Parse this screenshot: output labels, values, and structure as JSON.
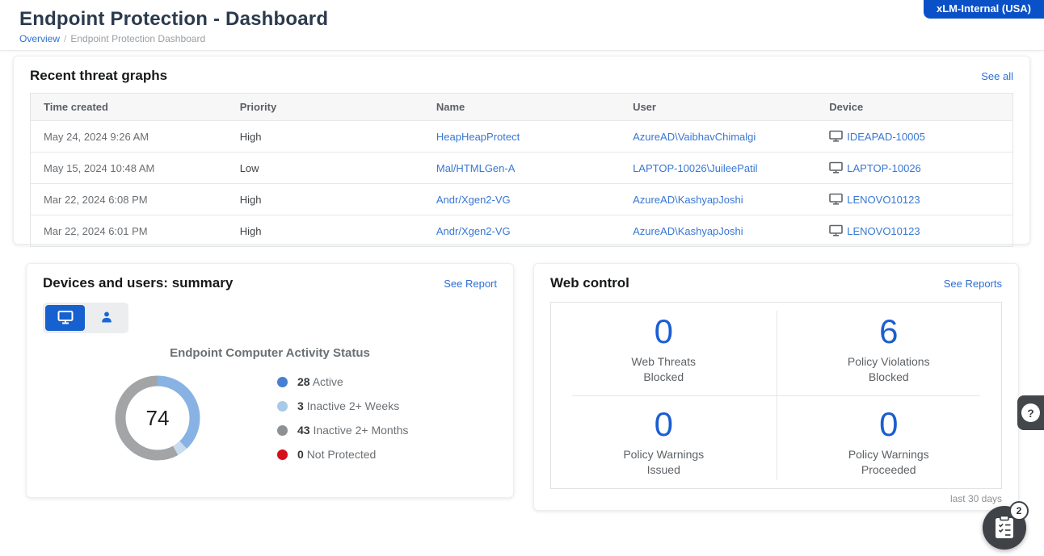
{
  "page": {
    "title": "Endpoint Protection - Dashboard",
    "breadcrumb": {
      "overview": "Overview",
      "separator": "/",
      "current": "Endpoint Protection Dashboard"
    },
    "region_badge": "xLM-Internal (USA)"
  },
  "threats": {
    "title": "Recent threat graphs",
    "see_all": "See all",
    "columns": [
      "Time created",
      "Priority",
      "Name",
      "User",
      "Device"
    ],
    "rows": [
      {
        "time": "May 24, 2024 9:26 AM",
        "priority": "High",
        "name": "HeapHeapProtect",
        "user": "AzureAD\\VaibhavChimalgi",
        "device": "IDEAPAD-10005"
      },
      {
        "time": "May 15, 2024 10:48 AM",
        "priority": "Low",
        "name": "Mal/HTMLGen-A",
        "user": "LAPTOP-10026\\JuileePatil",
        "device": "LAPTOP-10026"
      },
      {
        "time": "Mar 22, 2024 6:08 PM",
        "priority": "High",
        "name": "Andr/Xgen2-VG",
        "user": "AzureAD\\KashyapJoshi",
        "device": "LENOVO10123"
      },
      {
        "time": "Mar 22, 2024 6:01 PM",
        "priority": "High",
        "name": "Andr/Xgen2-VG",
        "user": "AzureAD\\KashyapJoshi",
        "device": "LENOVO10123"
      }
    ]
  },
  "devices_summary": {
    "title": "Devices and users: summary",
    "see_report": "See Report",
    "chart_data": {
      "type": "pie",
      "style": "donut",
      "title": "Endpoint Computer Activity Status",
      "total": "74",
      "legend_position": "right",
      "segments": [
        {
          "value": 28,
          "label": "Active",
          "dot_color": "#487ed2",
          "arc_color": "#89b2e4"
        },
        {
          "value": 3,
          "label": "Inactive 2+ Weeks",
          "dot_color": "#a9c9e9",
          "arc_color": "#c8dcf0"
        },
        {
          "value": 43,
          "label": "Inactive 2+ Months",
          "dot_color": "#8e9194",
          "arc_color": "#a2a4a6"
        },
        {
          "value": 0,
          "label": "Not Protected",
          "dot_color": "#d50f1b",
          "arc_color": "#d50f1b"
        }
      ]
    }
  },
  "web_control": {
    "title": "Web control",
    "see_reports": "See Reports",
    "stats": [
      {
        "value": "0",
        "label_line1": "Web Threats",
        "label_line2": "Blocked"
      },
      {
        "value": "6",
        "label_line1": "Policy Violations",
        "label_line2": "Blocked"
      },
      {
        "value": "0",
        "label_line1": "Policy Warnings",
        "label_line2": "Issued"
      },
      {
        "value": "0",
        "label_line1": "Policy Warnings",
        "label_line2": "Proceeded"
      }
    ],
    "footnote": "last 30 days"
  },
  "floating": {
    "help_label": "?",
    "tasks_badge_count": "2"
  },
  "colors": {
    "accent_blue": "#2e6fd4",
    "badge_blue": "#0a51c8",
    "stat_blue": "#1b5ed1",
    "dark_button": "#3f4347"
  }
}
